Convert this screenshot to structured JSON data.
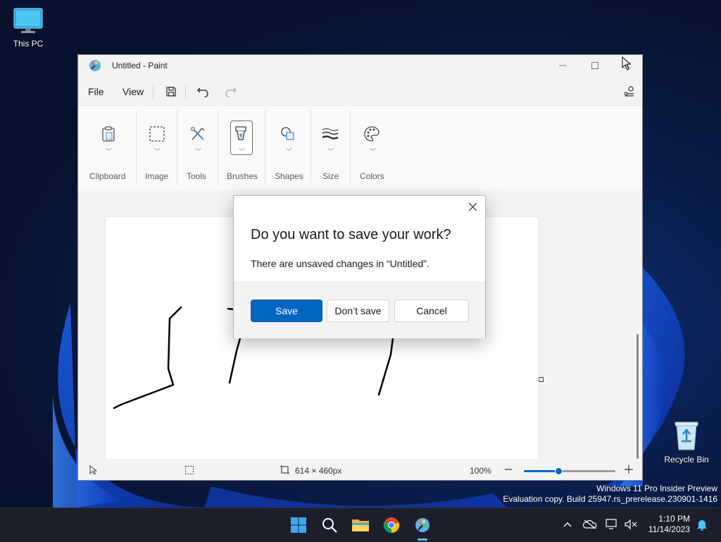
{
  "desktop": {
    "icons": [
      {
        "label": "This PC",
        "icon": "computer-icon"
      },
      {
        "label": "Recycle Bin",
        "icon": "recycle-bin-icon"
      }
    ],
    "watermark": {
      "line1": "Windows 11 Pro Insider Preview",
      "line2": "Evaluation copy. Build 25947.rs_prerelease.230901-1416"
    }
  },
  "window": {
    "title": "Untitled - Paint",
    "menus": [
      "File",
      "View"
    ],
    "quick_access": [
      "save-icon",
      "undo-icon",
      "redo-icon"
    ],
    "ribbon": {
      "groups": [
        {
          "label": "Clipboard",
          "icon": "clipboard-icon"
        },
        {
          "label": "Image",
          "icon": "selection-icon"
        },
        {
          "label": "Tools",
          "icon": "tools-icon"
        },
        {
          "label": "Brushes",
          "icon": "brush-icon",
          "selected": true
        },
        {
          "label": "Shapes",
          "icon": "shapes-icon"
        },
        {
          "label": "Size",
          "icon": "size-icon"
        },
        {
          "label": "Colors",
          "icon": "palette-icon"
        }
      ]
    },
    "status": {
      "canvas_size": "614 × 460px",
      "zoom": "100%",
      "zoom_level": 0.38
    }
  },
  "dialog": {
    "title": "Do you want to save your work?",
    "message": "There are unsaved changes in “Untitled”.",
    "buttons": {
      "save": "Save",
      "dont_save": "Don’t save",
      "cancel": "Cancel"
    }
  },
  "taskbar": {
    "apps": [
      "start-icon",
      "search-icon",
      "file-explorer-icon",
      "chrome-icon",
      "paint-icon"
    ],
    "clock": {
      "time": "1:10 PM",
      "date": "11/14/2023"
    }
  },
  "colors": {
    "accent": "#0067c0",
    "taskbar": "#1c1f2b",
    "window_bg": "#f3f3f3"
  }
}
